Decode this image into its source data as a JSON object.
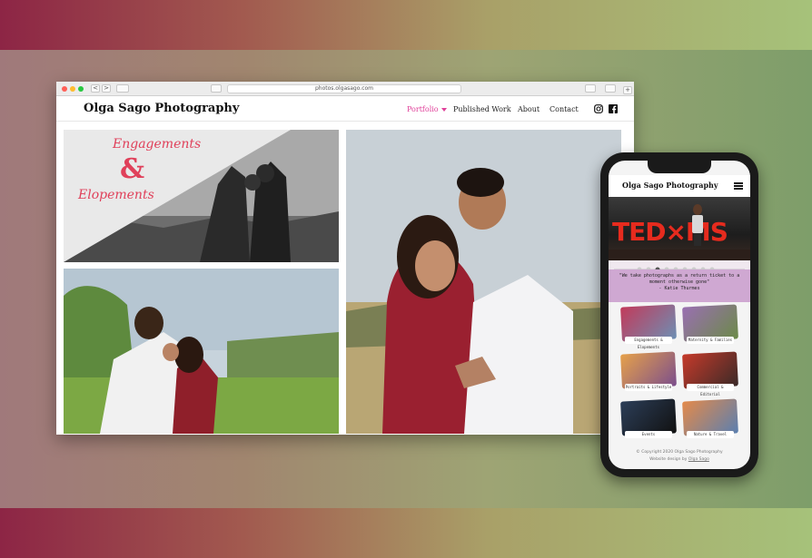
{
  "browser": {
    "url": "photos.olgasago.com",
    "nav_back": "<",
    "nav_forward": ">",
    "new_tab": "+"
  },
  "site": {
    "logo": "Olga Sago Photography",
    "nav": [
      {
        "label": "Portfolio",
        "active": true
      },
      {
        "label": "Published Work",
        "active": false
      },
      {
        "label": "About",
        "active": false
      },
      {
        "label": "Contact",
        "active": false
      }
    ],
    "hero_overlay": {
      "line1": "Engagements",
      "amp": "&",
      "line2": "Elopements"
    }
  },
  "mobile": {
    "logo": "Olga Sago Photography",
    "hero_text": "TED×MS",
    "quote": "\"We take photographs as a return ticket to a moment otherwise gone\"",
    "quote_author": "- Katie Thurmes",
    "categories": [
      {
        "label": "Engagements & Elopements"
      },
      {
        "label": "Maternity & Families"
      },
      {
        "label": "Portraits & Lifestyle"
      },
      {
        "label": "Commercial & Editorial"
      },
      {
        "label": "Events"
      },
      {
        "label": "Nature & Travel"
      }
    ],
    "footer_copyright": "© Copyright 2020 Olga Sago Photography",
    "footer_design_prefix": "Website design by",
    "footer_design_link": "Olga Sago"
  },
  "colors": {
    "accent": "#e0409a",
    "ted_red": "#e62b1e",
    "quote_bg": "#cfa8d2"
  },
  "icons": [
    "instagram-icon",
    "facebook-icon",
    "hamburger-menu-icon"
  ]
}
